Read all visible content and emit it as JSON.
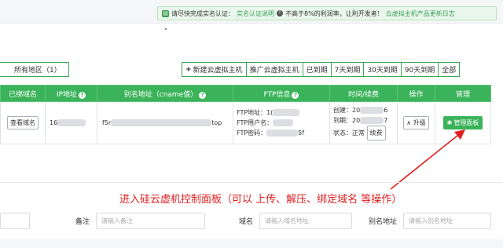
{
  "notice": {
    "text1": "请尽快完成实名认证：",
    "link1": "实名认证说明",
    "text2": "不高于8%的利润率，让利开发者！",
    "link2": "云虚拟主机产品更新日志"
  },
  "region_filter": {
    "label": "所有地区（1）"
  },
  "toolbar": {
    "new_host": "新建云虚拟主机",
    "promote": "推广云虚拟主机",
    "expired": "已到期",
    "d7": "7天到期",
    "d30": "30天到期",
    "d90": "90天到期",
    "all": "全部"
  },
  "table": {
    "headers": {
      "bound_domain": "已绑域名",
      "ip": "IP地址",
      "alias": "别名地址（cname值）",
      "ftp": "FTP信息",
      "time": "时间/续费",
      "ops": "操作",
      "manage": "管理"
    },
    "row": {
      "view_domain": "查看域名",
      "ip_prefix": "16",
      "alias_prefix": "f5r",
      "alias_suffix": "top",
      "ftp_addr_label": "FTP地址：",
      "ftp_addr_val": "1(",
      "ftp_user_label": "FTP用户名：",
      "ftp_pass_label": "FTP密码：",
      "ftp_pass_suffix": "5f",
      "created_label": "创建：",
      "created_val": "20",
      "created_end": "6",
      "expire_label": "到期：",
      "expire_val": "20",
      "expire_end": "7",
      "status_label": "状态：",
      "status_val": "正常",
      "renew": "续费",
      "upgrade": "升级",
      "manage_panel": "管理面板"
    }
  },
  "annotation": "进入硅云虚机控制面板（可以 上传、解压、绑定域名  等操作）",
  "filters": {
    "remark_label": "备注",
    "remark_placeholder": "请输入备注",
    "domain_label": "域名",
    "domain_placeholder": "请输入域名地址",
    "alias_label": "别名地址",
    "alias_placeholder": "请输入别名地址"
  },
  "colors": {
    "accent": "#3bb35a",
    "annotation": "#e02020"
  }
}
